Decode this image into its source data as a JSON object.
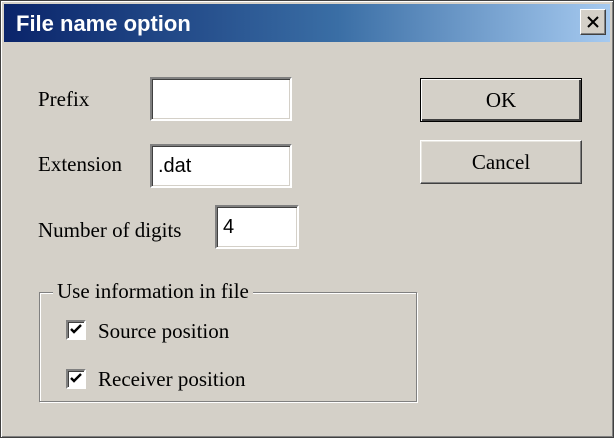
{
  "window": {
    "title": "File name option",
    "close_glyph": "close-x-icon"
  },
  "form": {
    "prefix_label": "Prefix",
    "prefix_value": "",
    "extension_label": "Extension",
    "extension_value": ".dat",
    "digits_label": "Number of digits",
    "digits_value": "4"
  },
  "buttons": {
    "ok": "OK",
    "cancel": "Cancel"
  },
  "group": {
    "title": "Use information in file",
    "options": [
      {
        "label": "Source position",
        "checked": true
      },
      {
        "label": "Receiver position",
        "checked": true
      }
    ]
  },
  "colors": {
    "title_gradient_start": "#0a246a",
    "title_gradient_end": "#a6caf0",
    "face": "#d4d0c8"
  }
}
